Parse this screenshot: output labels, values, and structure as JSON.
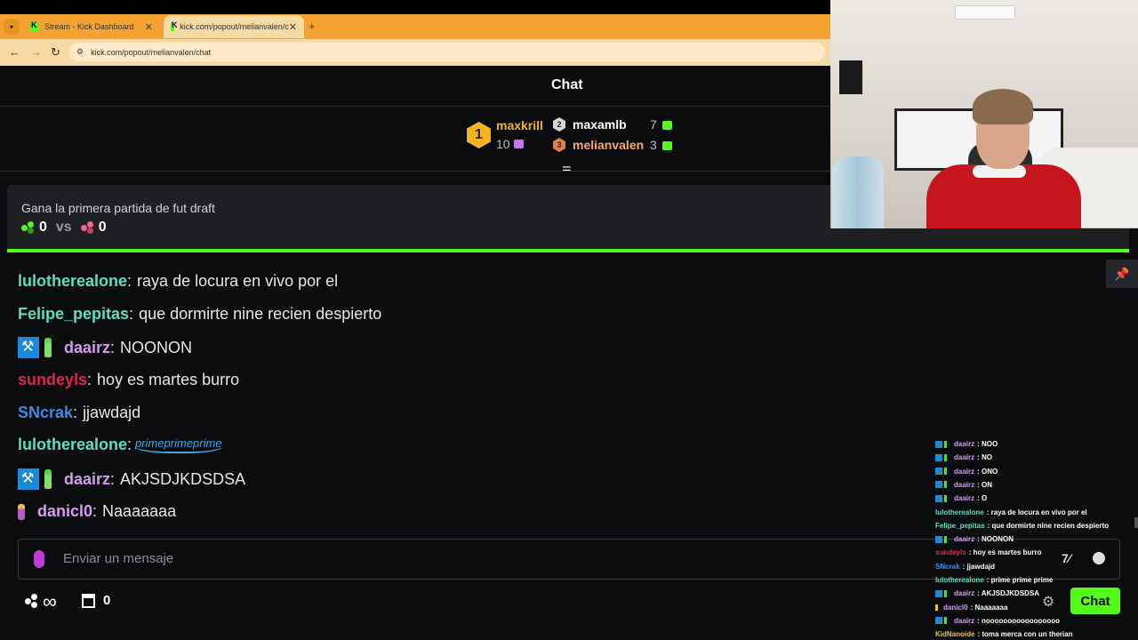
{
  "browser": {
    "tabs": [
      {
        "label": "Stream - Kick Dashboard",
        "active": false
      },
      {
        "label": "kick.com/popout/melianvalen/c",
        "active": true
      }
    ],
    "url": "kick.com/popout/melianvalen/chat"
  },
  "header": {
    "title": "Chat"
  },
  "leaderboard": [
    {
      "rank": "1",
      "name": "maxkrill",
      "count": "10",
      "name_color": "#f3b420"
    },
    {
      "rank": "2",
      "name": "maxamlb",
      "count": "7",
      "name_color": "#ffffff"
    },
    {
      "rank": "3",
      "name": "melianvalen",
      "count": "3",
      "name_color": "#f5a46b"
    }
  ],
  "poll": {
    "question": "Gana la primera partida de fut draft",
    "score_left": "0",
    "vs": "vs",
    "score_right": "0"
  },
  "messages": [
    {
      "user": "lulotherealone",
      "color": "#5ce0b8",
      "text": "raya de locura en vivo por el",
      "badges": []
    },
    {
      "user": "Felipe_pepitas",
      "color": "#5ce0b8",
      "text": "que dormirte nine recien despierto",
      "badges": []
    },
    {
      "user": "daairz",
      "color": "#d49bf0",
      "text": "NOONON",
      "badges": [
        "mod",
        "bottle"
      ]
    },
    {
      "user": "sundeyls",
      "color": "#e0244c",
      "text": "hoy es martes burro",
      "badges": []
    },
    {
      "user": "SNcrak",
      "color": "#3b8be6",
      "text": "jjawdajd",
      "badges": []
    },
    {
      "user": "lulotherealone",
      "color": "#5ce0b8",
      "text": "primeprimeprime",
      "badges": [],
      "emote": true
    },
    {
      "user": "daairz",
      "color": "#d49bf0",
      "text": "AKJSDJKDSDSA",
      "badges": [
        "mod",
        "bottle"
      ]
    },
    {
      "user": "danicl0",
      "color": "#d49bf0",
      "text": "Naaaaaaa",
      "badges": [
        "sub"
      ]
    }
  ],
  "input": {
    "placeholder": "Enviar un mensaje"
  },
  "footer": {
    "points": "∞",
    "store_count": "0",
    "chat_button": "Chat"
  },
  "overlay_chat": [
    {
      "user": "daairz",
      "text": "NOO",
      "color": "#d49bf0",
      "badges": true
    },
    {
      "user": "daairz",
      "text": "NO",
      "color": "#d49bf0",
      "badges": true
    },
    {
      "user": "daairz",
      "text": "ONO",
      "color": "#d49bf0",
      "badges": true
    },
    {
      "user": "daairz",
      "text": "ON",
      "color": "#d49bf0",
      "badges": true
    },
    {
      "user": "daairz",
      "text": "O",
      "color": "#d49bf0",
      "badges": true
    },
    {
      "user": "lulotherealone",
      "text": "raya de locura en vivo por el",
      "color": "#5ce0b8",
      "badges": false
    },
    {
      "user": "Felipe_pepitas",
      "text": "que dormirte nine recien despierto",
      "color": "#5ce0b8",
      "badges": false
    },
    {
      "user": "daairz",
      "text": "NOONON",
      "color": "#d49bf0",
      "badges": true
    },
    {
      "user": "sundeyls",
      "text": "hoy es martes burro",
      "color": "#e0244c",
      "badges": false
    },
    {
      "user": "SNcrak",
      "text": "jjawdajd",
      "color": "#3b8be6",
      "badges": false
    },
    {
      "user": "lulotherealone",
      "text": "prime prime prime",
      "color": "#5ce0b8",
      "badges": false
    },
    {
      "user": "daairz",
      "text": "AKJSDJKDSDSA",
      "color": "#d49bf0",
      "badges": true
    },
    {
      "user": "danicl0",
      "text": "Naaaaaaa",
      "color": "#d49bf0",
      "badges": "sub"
    },
    {
      "user": "daairz",
      "text": "nooooooooooooooooo",
      "color": "#d49bf0",
      "badges": true
    },
    {
      "user": "KidNanoide",
      "text": "toma merca con un therian",
      "color": "#e6c15a",
      "badges": false
    }
  ],
  "colors": {
    "accent": "#53fc18",
    "background": "#0b0c0e"
  }
}
